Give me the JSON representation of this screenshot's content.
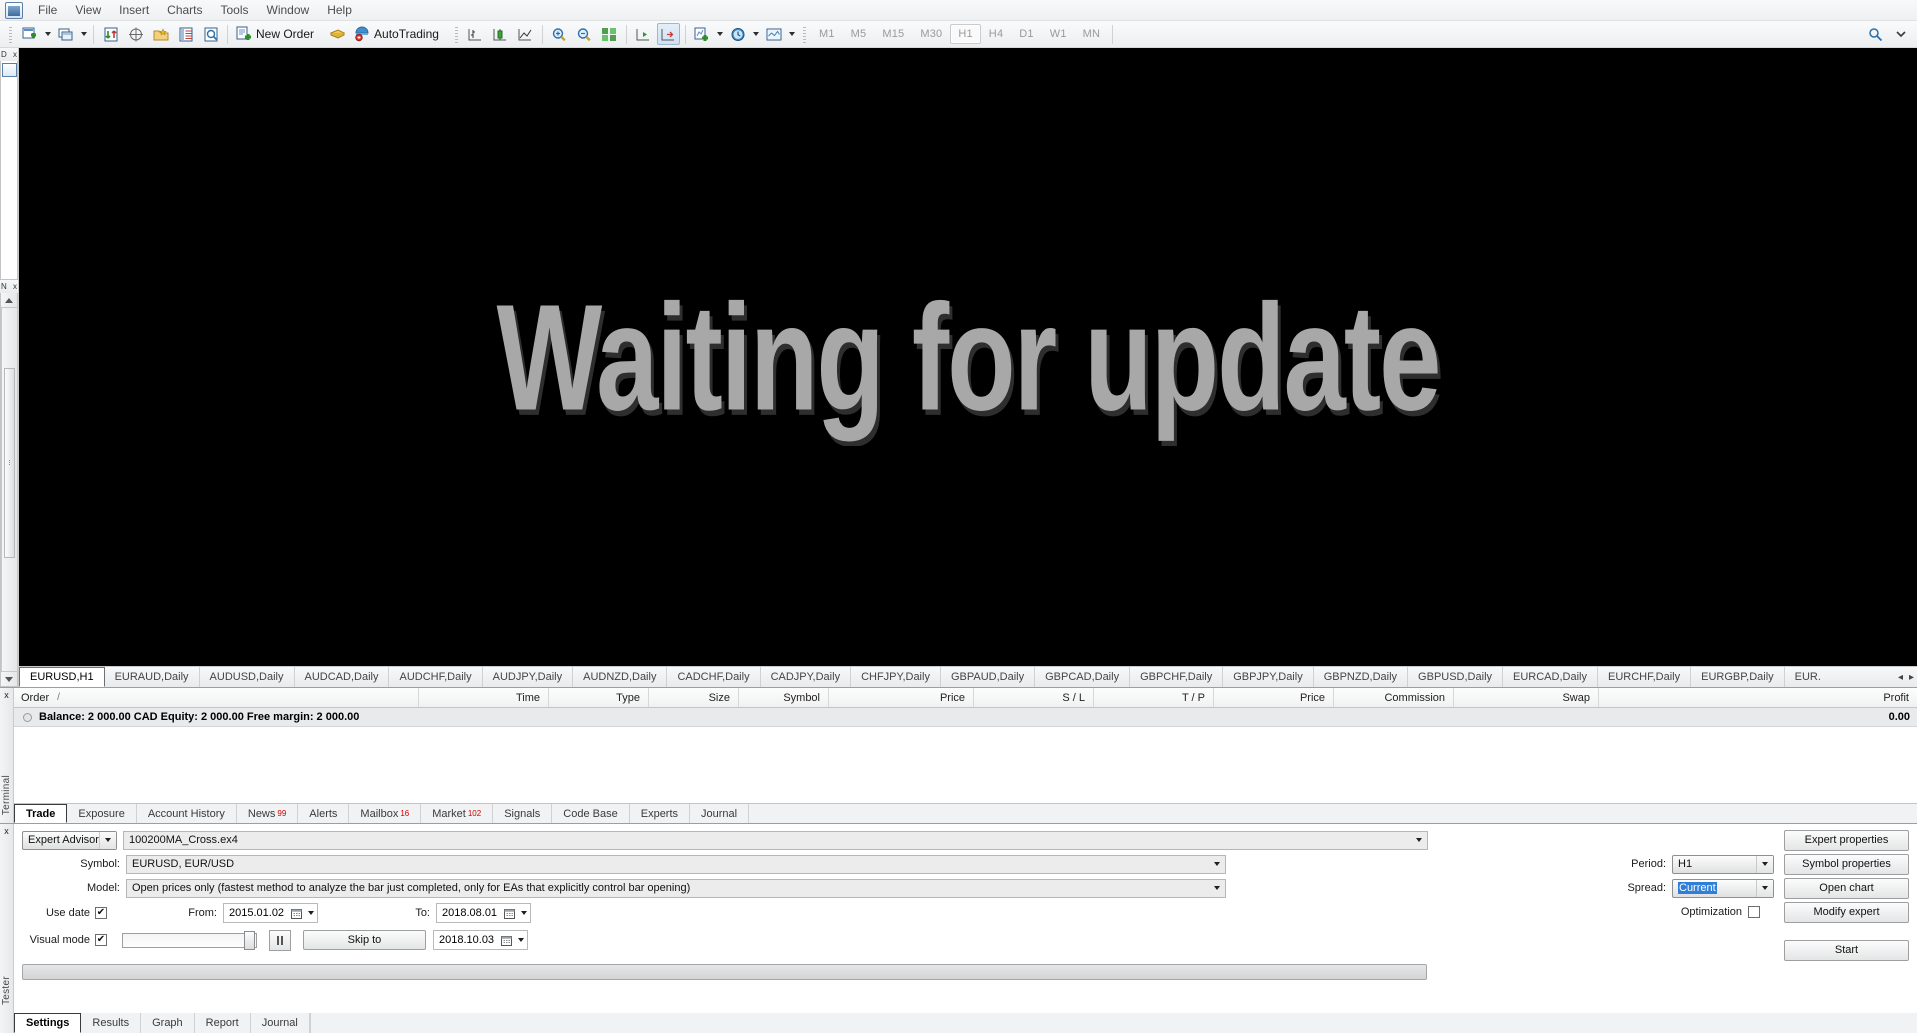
{
  "app": {
    "title": "MetaTrader 4"
  },
  "menu": {
    "items": [
      "File",
      "View",
      "Insert",
      "Charts",
      "Tools",
      "Window",
      "Help"
    ]
  },
  "toolbar": {
    "new_order_label": "New Order",
    "autotrading_label": "AutoTrading",
    "icons": [
      "new-chart-icon",
      "profiles-icon",
      "market-watch-icon",
      "data-window-icon",
      "navigator-icon",
      "terminal-icon",
      "strategy-tester-icon",
      "bar-chart-icon",
      "candlestick-chart-icon",
      "line-chart-icon",
      "zoom-in-icon",
      "zoom-out-icon",
      "tile-windows-icon",
      "auto-scroll-icon",
      "chart-shift-icon",
      "indicators-icon",
      "timeframes-icon",
      "templates-icon"
    ],
    "timeframes": [
      "M1",
      "M5",
      "M15",
      "M30",
      "H1",
      "H4",
      "D1",
      "W1",
      "MN"
    ],
    "active_timeframe": "H1"
  },
  "left_dock": {
    "panel_top": {
      "title": "D",
      "close": "x"
    },
    "panel_bottom": {
      "title": "N",
      "close": "x"
    }
  },
  "chart": {
    "status_text": "Waiting for update",
    "tabs": [
      "EURUSD,H1",
      "EURAUD,Daily",
      "AUDUSD,Daily",
      "AUDCAD,Daily",
      "AUDCHF,Daily",
      "AUDJPY,Daily",
      "AUDNZD,Daily",
      "CADCHF,Daily",
      "CADJPY,Daily",
      "CHFJPY,Daily",
      "GBPAUD,Daily",
      "GBPCAD,Daily",
      "GBPCHF,Daily",
      "GBPJPY,Daily",
      "GBPNZD,Daily",
      "GBPUSD,Daily",
      "EURCAD,Daily",
      "EURCHF,Daily",
      "EURGBP,Daily",
      "EUR."
    ],
    "active_tab": "EURUSD,H1",
    "scroll_left": "◂",
    "scroll_right": "▸"
  },
  "terminal": {
    "side_label": "Terminal",
    "close": "x",
    "columns": [
      "Order",
      "Time",
      "Type",
      "Size",
      "Symbol",
      "Price",
      "S / L",
      "T / P",
      "Price",
      "Commission",
      "Swap",
      "Profit"
    ],
    "sort_marker": "/",
    "balance_line": "Balance: 2 000.00 CAD  Equity: 2 000.00  Free margin: 2 000.00",
    "balance_profit": "0.00",
    "tabs": [
      {
        "label": "Trade",
        "badge": ""
      },
      {
        "label": "Exposure",
        "badge": ""
      },
      {
        "label": "Account History",
        "badge": ""
      },
      {
        "label": "News",
        "badge": "99"
      },
      {
        "label": "Alerts",
        "badge": ""
      },
      {
        "label": "Mailbox",
        "badge": "16"
      },
      {
        "label": "Market",
        "badge": "102"
      },
      {
        "label": "Signals",
        "badge": ""
      },
      {
        "label": "Code Base",
        "badge": ""
      },
      {
        "label": "Experts",
        "badge": ""
      },
      {
        "label": "Journal",
        "badge": ""
      }
    ],
    "active_tab": "Trade"
  },
  "tester": {
    "side_label": "Tester",
    "close": "x",
    "type_select": "Expert Advisor",
    "expert_file": "100200MA_Cross.ex4",
    "symbol_label": "Symbol:",
    "symbol_value": "EURUSD, EUR/USD",
    "model_label": "Model:",
    "model_value": "Open prices only (fastest method to analyze the bar just completed, only for EAs that explicitly control bar opening)",
    "use_date_label": "Use date",
    "use_date_checked": "✔",
    "from_label": "From:",
    "from_value": "2015.01.02",
    "to_label": "To:",
    "to_value": "2018.08.01",
    "visual_mode_label": "Visual mode",
    "visual_mode_checked": "✔",
    "skip_to_label": "Skip to",
    "skip_to_value": "2018.10.03",
    "period_label": "Period:",
    "period_value": "H1",
    "spread_label": "Spread:",
    "spread_value": "Current",
    "optimization_label": "Optimization",
    "optimization_checked": "",
    "buttons": {
      "expert_properties": "Expert properties",
      "symbol_properties": "Symbol properties",
      "open_chart": "Open chart",
      "modify_expert": "Modify expert",
      "start": "Start"
    },
    "tabs": [
      "Settings",
      "Results",
      "Graph",
      "Report",
      "Journal"
    ],
    "active_tab": "Settings"
  },
  "colors": {
    "chart_bg": "#000000",
    "waiting_text": "#a8a8a8",
    "badge_red": "#d00000",
    "selection_blue": "#2f7fd8",
    "accent": "#2f7fd8"
  }
}
